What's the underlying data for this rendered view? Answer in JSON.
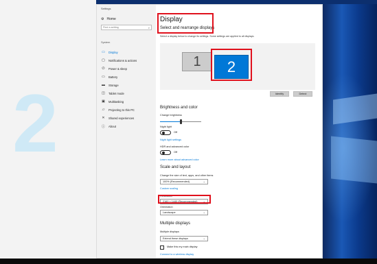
{
  "watermark": "2",
  "window": {
    "title": "Settings"
  },
  "sidebar": {
    "home_label": "Home",
    "search_placeholder": "Find a setting",
    "section_label": "System",
    "items": [
      {
        "label": "Display",
        "icon": "display-icon",
        "active": true
      },
      {
        "label": "Notifications & actions",
        "icon": "notifications-icon"
      },
      {
        "label": "Power & sleep",
        "icon": "power-icon"
      },
      {
        "label": "Battery",
        "icon": "battery-icon"
      },
      {
        "label": "Storage",
        "icon": "storage-icon"
      },
      {
        "label": "Tablet mode",
        "icon": "tablet-icon"
      },
      {
        "label": "Multitasking",
        "icon": "multitasking-icon"
      },
      {
        "label": "Projecting to this PC",
        "icon": "projecting-icon"
      },
      {
        "label": "Shared experiences",
        "icon": "shared-icon"
      },
      {
        "label": "About",
        "icon": "about-icon"
      }
    ]
  },
  "main": {
    "page_title": "Display",
    "section_title": "Select and rearrange displays",
    "description": "Select a display below to change its settings. Some settings are applied to all displays.",
    "monitors": [
      "1",
      "2"
    ],
    "identify_label": "Identify",
    "detect_label": "Detect",
    "brightness_title": "Brightness and color",
    "brightness_label": "Change brightness",
    "brightness_value": 0.5,
    "night_light_label": "Night light",
    "night_light_state": "Off",
    "night_light_settings": "Night light settings",
    "hdr_label": "HDR and advanced color",
    "hdr_state": "Off",
    "hdr_link": "Learn more about advanced color",
    "scale_title": "Scale and layout",
    "scale_label": "Change the size of text, apps, and other items",
    "scale_value": "100% (Recommended)",
    "custom_scaling": "Custom scaling",
    "resolution_label": "Resolution",
    "resolution_value": "2160 × 1440 (Recommended)",
    "orientation_label": "Orientation",
    "orientation_value": "Landscape",
    "multiple_title": "Multiple displays",
    "multiple_label": "Multiple displays",
    "multiple_value": "Extend these displays",
    "main_display_label": "Make this my main display",
    "wireless_link": "Connect to a wireless display"
  },
  "colors": {
    "accent": "#0078d7",
    "highlight": "#e0101c"
  }
}
